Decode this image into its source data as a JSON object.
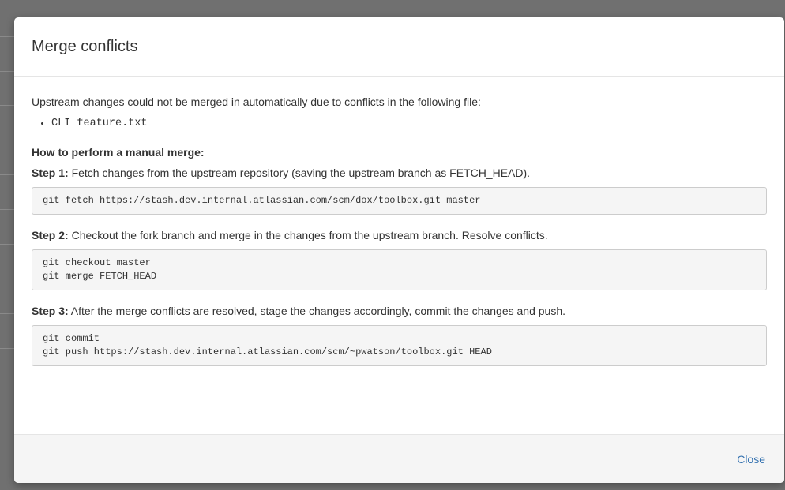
{
  "dialog": {
    "title": "Merge conflicts",
    "intro": "Upstream changes could not be merged in automatically due to conflicts in the following file:",
    "conflict_files": [
      "CLI feature.txt"
    ],
    "howto_heading": "How to perform a manual merge:",
    "steps": [
      {
        "label": "Step 1:",
        "text": " Fetch changes from the upstream repository (saving the upstream branch as FETCH_HEAD).",
        "code": [
          "git fetch https://stash.dev.internal.atlassian.com/scm/dox/toolbox.git master"
        ]
      },
      {
        "label": "Step 2:",
        "text": " Checkout the fork branch and merge in the changes from the upstream branch. Resolve conflicts.",
        "code": [
          "git checkout master",
          "git merge FETCH_HEAD"
        ]
      },
      {
        "label": "Step 3:",
        "text": " After the merge conflicts are resolved, stage the changes accordingly, commit the changes and push.",
        "code": [
          "git commit",
          "git push https://stash.dev.internal.atlassian.com/scm/~pwatson/toolbox.git HEAD"
        ]
      }
    ],
    "close_label": "Close"
  },
  "colors": {
    "link": "#3572b0",
    "overlay": "#707070",
    "code_background": "#f5f5f5"
  }
}
